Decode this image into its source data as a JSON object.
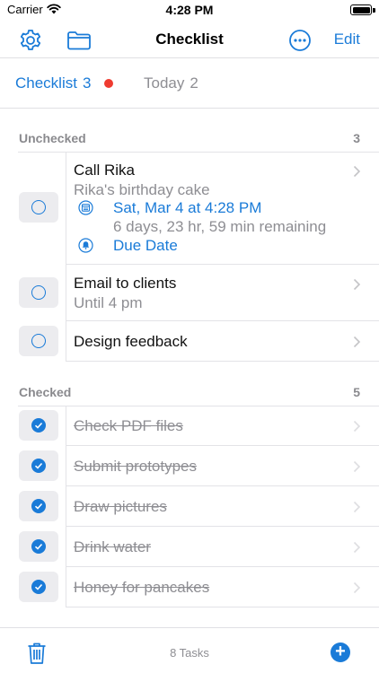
{
  "status_bar": {
    "carrier": "Carrier",
    "time": "4:28 PM"
  },
  "nav": {
    "title": "Checklist",
    "edit_label": "Edit",
    "left_icons": [
      "gear-icon",
      "folder-icon"
    ],
    "right_icons": [
      "more-icon"
    ]
  },
  "tabs": [
    {
      "label": "Checklist",
      "count": "3",
      "active": true
    },
    {
      "label": "Today",
      "count": "2",
      "active": false
    }
  ],
  "unchecked": {
    "title": "Unchecked",
    "count": "3",
    "items": [
      {
        "title": "Call Rika",
        "note": "Rika's birthday cake",
        "date": "Sat, Mar 4 at 4:28 PM",
        "remaining": "6 days, 23 hr, 59 min remaining",
        "alert": "Due Date"
      },
      {
        "title": "Email to clients",
        "note": "Until 4 pm"
      },
      {
        "title": "Design feedback"
      }
    ]
  },
  "checked": {
    "title": "Checked",
    "count": "5",
    "items": [
      {
        "title": "Check PDF files"
      },
      {
        "title": "Submit prototypes"
      },
      {
        "title": "Draw pictures"
      },
      {
        "title": "Drink water"
      },
      {
        "title": "Honey for pancakes"
      }
    ]
  },
  "bottom": {
    "task_count": "8 Tasks"
  },
  "colors": {
    "accent": "#1a7bd8",
    "badge": "#ef3b30",
    "muted": "#8e8e93"
  }
}
